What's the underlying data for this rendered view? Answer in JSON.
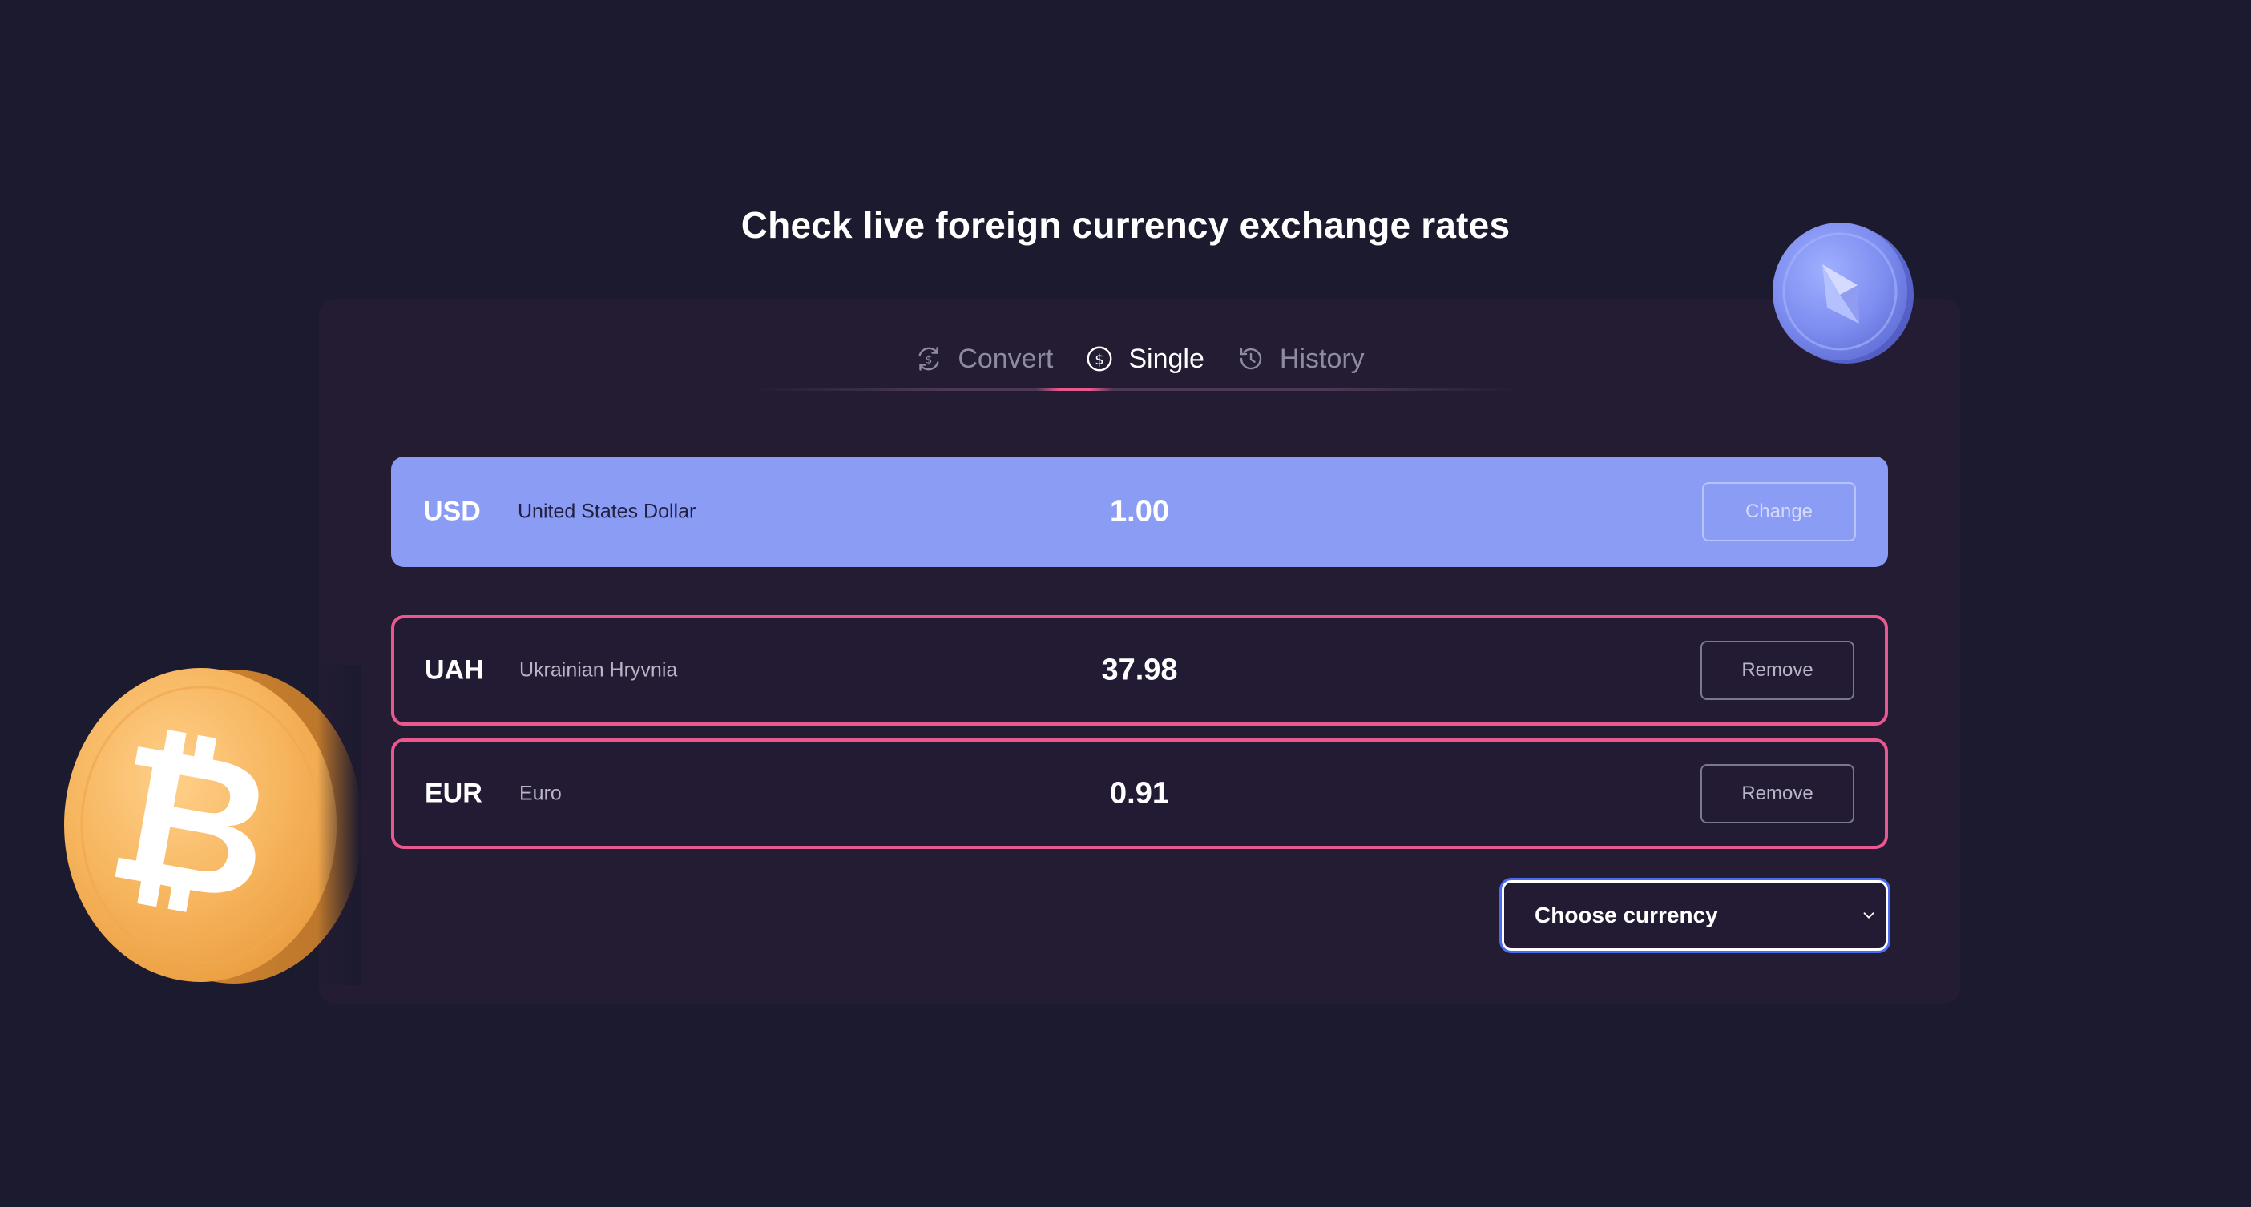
{
  "page": {
    "title": "Check live foreign currency exchange rates"
  },
  "tabs": [
    {
      "label": "Convert",
      "icon": "convert-icon",
      "active": false
    },
    {
      "label": "Single",
      "icon": "dollar-icon",
      "active": true
    },
    {
      "label": "History",
      "icon": "history-icon",
      "active": false
    }
  ],
  "base_currency": {
    "code": "USD",
    "name": "United States Dollar",
    "amount": "1.00",
    "button_label": "Change"
  },
  "rates": [
    {
      "code": "UAH",
      "name": "Ukrainian Hryvnia",
      "amount": "37.98",
      "button_label": "Remove"
    },
    {
      "code": "EUR",
      "name": "Euro",
      "amount": "0.91",
      "button_label": "Remove"
    }
  ],
  "currency_select": {
    "value": "Choose currency",
    "icon": "chevron-down-icon"
  },
  "decorations": {
    "coin_top_right": "ethereum-coin-icon",
    "coin_bottom_left": "bitcoin-coin-icon"
  },
  "colors": {
    "background": "#1c1a2e",
    "panel": "#231c33",
    "base_row": "#8b9cf5",
    "accent_pink": "#e9588e",
    "select_focus": "#4a6cf0"
  }
}
